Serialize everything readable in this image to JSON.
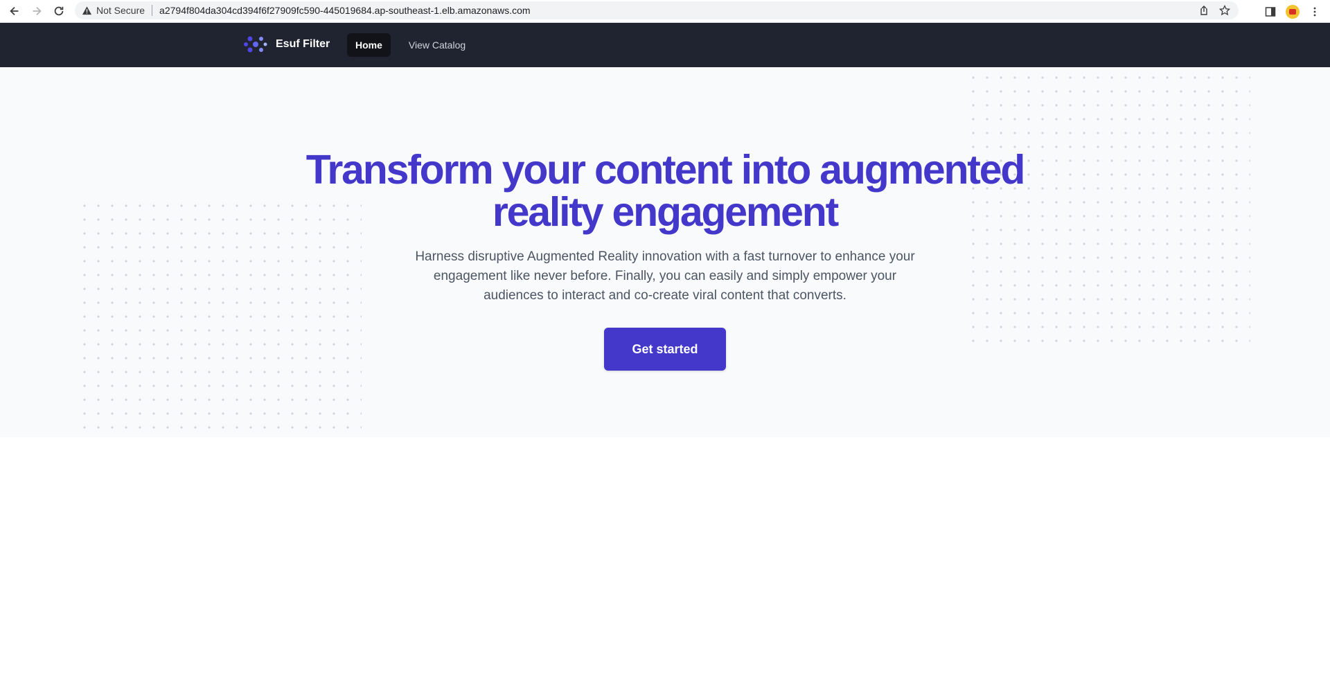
{
  "browser": {
    "security_label": "Not Secure",
    "url": "a2794f804da304cd394f6f27909fc590-445019684.ap-southeast-1.elb.amazonaws.com"
  },
  "nav": {
    "brand": "Esuf Filter",
    "links": [
      {
        "label": "Home",
        "active": true
      },
      {
        "label": "View Catalog",
        "active": false
      }
    ]
  },
  "hero": {
    "title_line1": "Transform your content into augmented",
    "title_line2": "reality engagement",
    "subtitle_line1": "Harness disruptive Augmented Reality innovation with a fast turnover to enhance your",
    "subtitle_line2": "engagement like never before. Finally, you can easily and simply empower your",
    "subtitle_line3": "audiences to interact and co-create viral content that converts.",
    "cta_label": "Get started"
  },
  "colors": {
    "nav_bg": "#1f2430",
    "accent": "#4338ca",
    "hero_bg": "#f9fafb"
  }
}
